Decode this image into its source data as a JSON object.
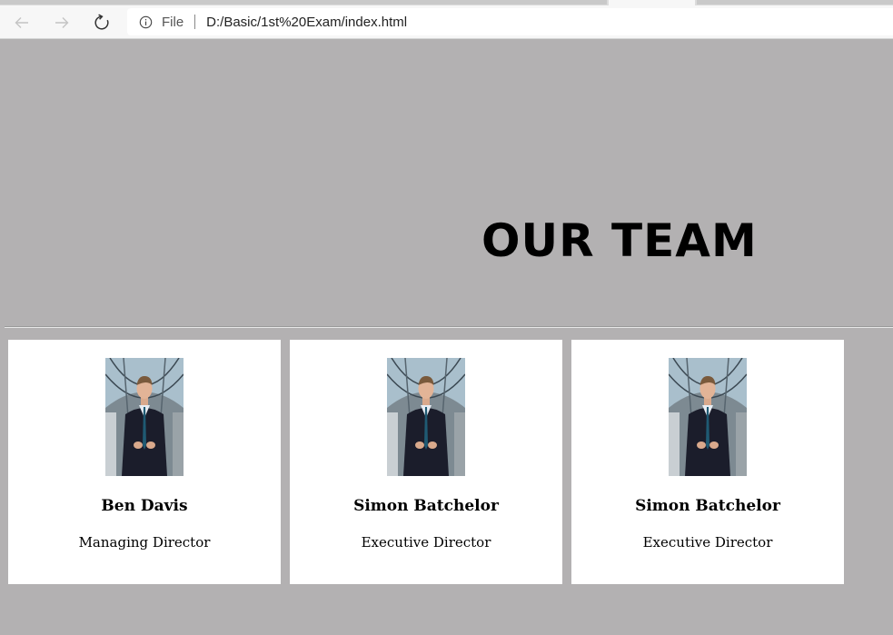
{
  "browser": {
    "address_bar": {
      "security_label": "File",
      "url": "D:/Basic/1st%20Exam/index.html"
    },
    "icons": {
      "back": "arrow-left-icon",
      "forward": "arrow-right-icon",
      "reload": "reload-icon",
      "info": "info-circle-icon"
    }
  },
  "page": {
    "background_color": "#b3b1b2",
    "title": "OUR TEAM",
    "team": [
      {
        "name": "Ben Davis",
        "role": "Managing Director"
      },
      {
        "name": "Simon Batchelor",
        "role": "Executive Director"
      },
      {
        "name": "Simon Batchelor",
        "role": "Executive Director"
      }
    ]
  }
}
